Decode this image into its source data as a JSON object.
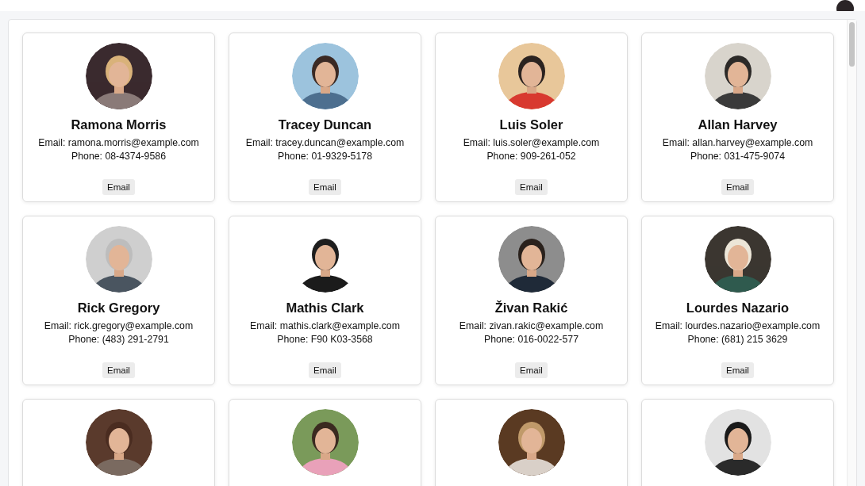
{
  "contacts": [
    {
      "avatar": {
        "kind": "picture"
      },
      "name": "Ramona Morris",
      "email": "Email: ramona.morris@example.com",
      "phone": "Phone: 08-4374-9586",
      "button": "Email"
    },
    {
      "avatar": {
        "kind": "picture"
      },
      "name": "Tracey Duncan",
      "email": "Email: tracey.duncan@example.com",
      "phone": "Phone: 01-9329-5178",
      "button": "Email"
    },
    {
      "avatar": {
        "kind": "picture"
      },
      "name": "Luis Soler",
      "email": "Email: luis.soler@example.com",
      "phone": "Phone: 909-261-052",
      "button": "Email"
    },
    {
      "avatar": {
        "kind": "picture"
      },
      "name": "Allan Harvey",
      "email": "Email: allan.harvey@example.com",
      "phone": "Phone: 031-475-9074",
      "button": "Email"
    },
    {
      "avatar": {
        "kind": "picture"
      },
      "name": "Rick Gregory",
      "email": "Email: rick.gregory@example.com",
      "phone": "Phone: (483) 291-2791",
      "button": "Email"
    },
    {
      "avatar": {
        "kind": "picture"
      },
      "name": "Mathis Clark",
      "email": "Email: mathis.clark@example.com",
      "phone": "Phone: F90 K03-3568",
      "button": "Email"
    },
    {
      "avatar": {
        "kind": "picture"
      },
      "name": "Živan Rakić",
      "email": "Email: zivan.rakic@example.com",
      "phone": "Phone: 016-0022-577",
      "button": "Email"
    },
    {
      "avatar": {
        "kind": "picture"
      },
      "name": "Lourdes Nazario",
      "email": "Email: lourdes.nazario@example.com",
      "phone": "Phone: (681) 215 3629",
      "button": "Email"
    },
    {
      "avatar": {
        "kind": "picture"
      }
    },
    {
      "avatar": {
        "kind": "picture"
      }
    },
    {
      "avatar": {
        "kind": "picture"
      }
    },
    {
      "avatar": {
        "kind": "picture"
      }
    }
  ]
}
